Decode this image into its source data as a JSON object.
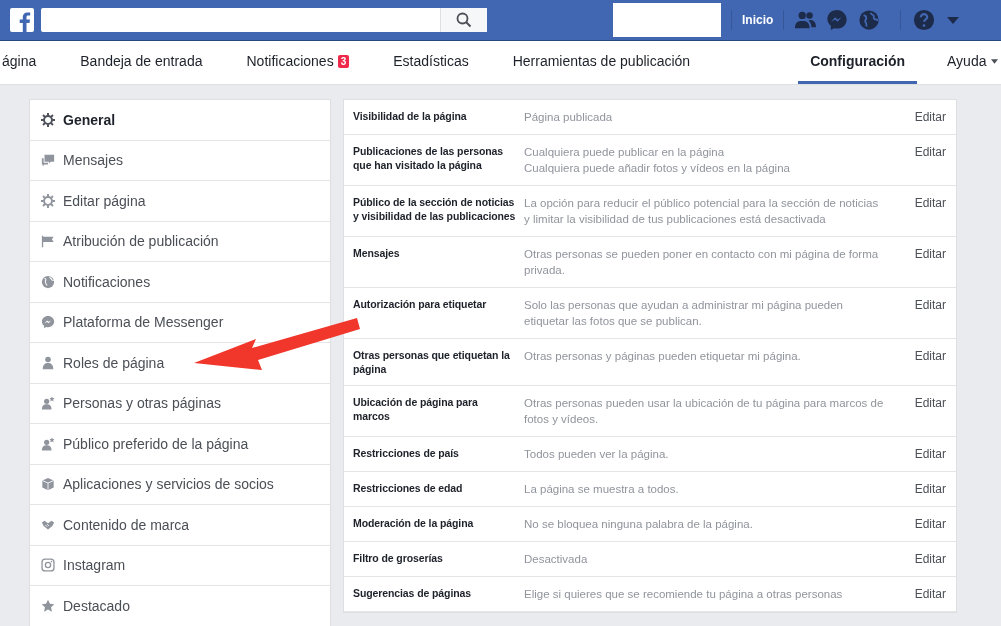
{
  "top_bar": {
    "home_link": "Inicio"
  },
  "tabs": [
    {
      "label": "ágina",
      "selected": false
    },
    {
      "label": "Bandeja de entrada",
      "selected": false
    },
    {
      "label": "Notificaciones",
      "selected": false,
      "badge": "3"
    },
    {
      "label": "Estadísticas",
      "selected": false
    },
    {
      "label": "Herramientas de publicación",
      "selected": false
    },
    {
      "label": "Configuración",
      "selected": true
    },
    {
      "label": "Ayuda",
      "selected": false,
      "dropdown": true
    }
  ],
  "sidebar": {
    "items": [
      {
        "label": "General",
        "selected": true
      },
      {
        "label": "Mensajes",
        "selected": false
      },
      {
        "label": "Editar página",
        "selected": false
      },
      {
        "label": "Atribución de publicación",
        "selected": false
      },
      {
        "label": "Notificaciones",
        "selected": false
      },
      {
        "label": "Plataforma de Messenger",
        "selected": false
      },
      {
        "label": "Roles de página",
        "selected": false
      },
      {
        "label": "Personas y otras páginas",
        "selected": false
      },
      {
        "label": "Público preferido de la página",
        "selected": false
      },
      {
        "label": "Aplicaciones y servicios de socios",
        "selected": false
      },
      {
        "label": "Contenido de marca",
        "selected": false
      },
      {
        "label": "Instagram",
        "selected": false
      },
      {
        "label": "Destacado",
        "selected": false
      }
    ]
  },
  "settings": [
    {
      "name": "Visibilidad de la página",
      "value": [
        "Página publicada"
      ],
      "action": "Editar"
    },
    {
      "name": "Publicaciones de las personas que han visitado la página",
      "value": [
        "Cualquiera puede publicar en la página",
        "Cualquiera puede añadir fotos y vídeos en la página"
      ],
      "action": "Editar"
    },
    {
      "name": "Público de la sección de noticias y visibilidad de las publicaciones",
      "value": [
        "La opción para reducir el público potencial para la sección de noticias y limitar la visibilidad de tus publicaciones está desactivada"
      ],
      "action": "Editar"
    },
    {
      "name": "Mensajes",
      "value": [
        "Otras personas se pueden poner en contacto con mi página de forma privada."
      ],
      "action": "Editar"
    },
    {
      "name": "Autorización para etiquetar",
      "value": [
        "Solo las personas que ayudan a administrar mi página pueden etiquetar las fotos que se publican."
      ],
      "action": "Editar"
    },
    {
      "name": "Otras personas que etiquetan la página",
      "value": [
        "Otras personas y páginas pueden etiquetar mi página."
      ],
      "action": "Editar"
    },
    {
      "name": "Ubicación de página para marcos",
      "value": [
        "Otras personas pueden usar la ubicación de tu página para marcos de fotos y vídeos."
      ],
      "action": "Editar"
    },
    {
      "name": "Restricciones de país",
      "value": [
        "Todos pueden ver la página."
      ],
      "action": "Editar"
    },
    {
      "name": "Restricciones de edad",
      "value": [
        "La página se muestra a todos."
      ],
      "action": "Editar"
    },
    {
      "name": "Moderación de la página",
      "value": [
        "No se bloquea ninguna palabra de la página."
      ],
      "action": "Editar"
    },
    {
      "name": "Filtro de groserías",
      "value": [
        "Desactivada"
      ],
      "action": "Editar"
    },
    {
      "name": "Sugerencias de páginas",
      "value": [
        "Elige si quieres que se recomiende tu página a otras personas"
      ],
      "action": "Editar"
    }
  ]
}
